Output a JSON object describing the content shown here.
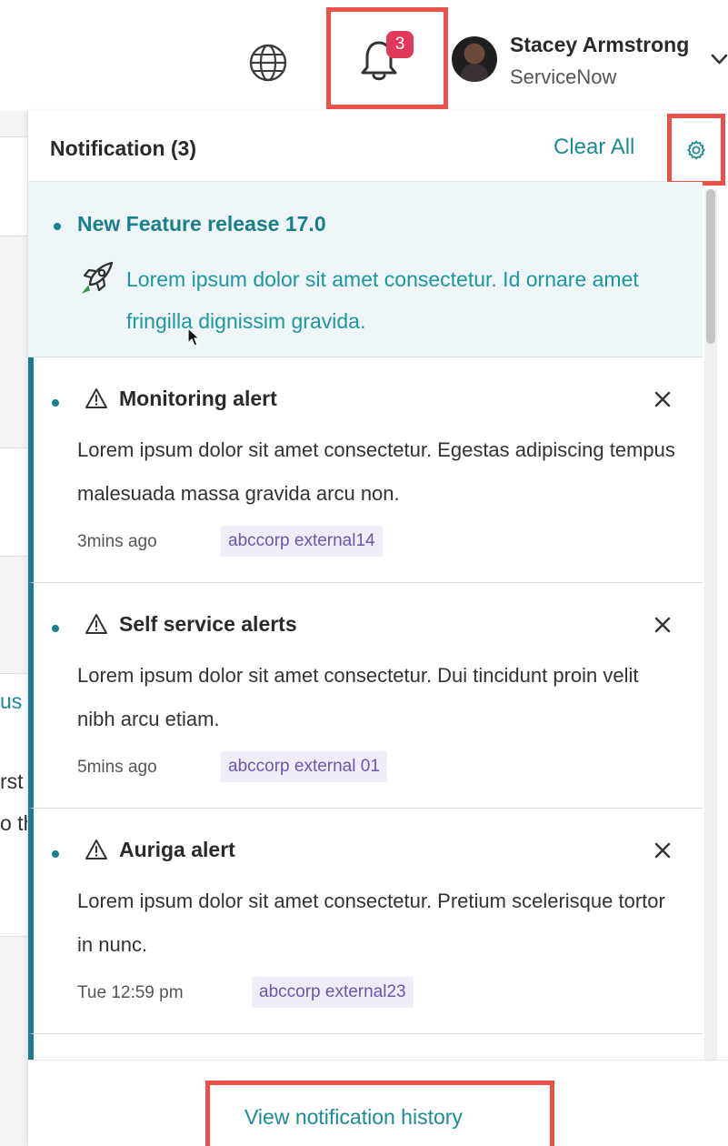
{
  "header": {
    "notification_count": "3",
    "user_name": "Stacey Armstrong",
    "user_org": "ServiceNow"
  },
  "background": {
    "fragment_1": "us",
    "fragment_2": "rst",
    "fragment_3": "o th"
  },
  "panel": {
    "title": "Notification (3)",
    "clear_all_label": "Clear All",
    "feature": {
      "title": "New Feature release 17.0",
      "body": "Lorem ipsum dolor sit amet consectetur. Id ornare amet fringilla dignissim gravida."
    },
    "notifications": [
      {
        "title": "Monitoring alert",
        "body": "Lorem ipsum dolor sit amet consectetur. Egestas adipiscing tempus malesuada massa gravida arcu non.",
        "time": "3mins ago",
        "tag": "abccorp external14"
      },
      {
        "title": "Self service alerts",
        "body": "Lorem ipsum dolor sit amet consectetur. Dui tincidunt proin velit nibh arcu etiam.",
        "time": "5mins ago",
        "tag": "abccorp external 01"
      },
      {
        "title": "Auriga alert",
        "body": "Lorem ipsum dolor sit amet consectetur. Pretium scelerisque tortor in nunc.",
        "time": "Tue 12:59 pm",
        "tag": "abccorp external23"
      }
    ],
    "history_label": "View notification history"
  },
  "colors": {
    "accent": "#1c8b95",
    "highlight_box": "#e8524a",
    "badge": "#e0395a",
    "tag_bg": "#f0edf8",
    "tag_text": "#6a57b0",
    "unread_bar": "#1a7c8f"
  },
  "icons": {
    "globe": "globe-icon",
    "bell": "bell-icon",
    "settings": "gear-icon",
    "feature": "rocket-icon",
    "alert": "warning-icon",
    "dismiss": "close-icon"
  }
}
